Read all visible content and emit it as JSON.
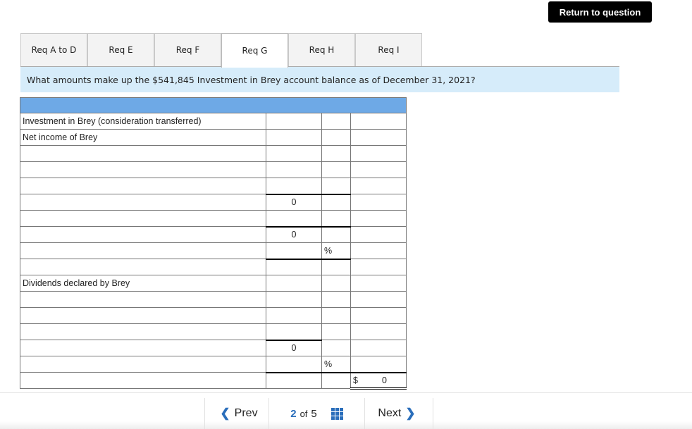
{
  "header": {
    "return_label": "Return to question"
  },
  "tabs": [
    {
      "label": "Req A to D",
      "active": false
    },
    {
      "label": "Req E",
      "active": false
    },
    {
      "label": "Req F",
      "active": false
    },
    {
      "label": "Req G",
      "active": true
    },
    {
      "label": "Req H",
      "active": false
    },
    {
      "label": "Req I",
      "active": false
    }
  ],
  "question": "What amounts make up the $541,845 Investment in Brey account balance as of December 31, 2021?",
  "sheet": {
    "header_color": "#6ea9e6",
    "rows": [
      {
        "label": "Investment in Brey (consideration transferred)",
        "c2": "",
        "c3": "",
        "c4": ""
      },
      {
        "label": "Net income of Brey",
        "c2": "",
        "c3": "",
        "c4": ""
      },
      {
        "label": "",
        "c2": "",
        "c3": "",
        "c4": ""
      },
      {
        "label": "",
        "c2": "",
        "c3": "",
        "c4": ""
      },
      {
        "label": "",
        "c2": "",
        "c3": "",
        "c4": ""
      },
      {
        "label": "",
        "c2": "0",
        "c3": "",
        "c4": ""
      },
      {
        "label": "",
        "c2": "",
        "c3": "",
        "c4": ""
      },
      {
        "label": "",
        "c2": "0",
        "c3": "",
        "c4": ""
      },
      {
        "label": "",
        "c2": "",
        "c3": "%",
        "c4": ""
      },
      {
        "label": "",
        "c2": "",
        "c3": "",
        "c4": ""
      },
      {
        "label": "Dividends declared by Brey",
        "c2": "",
        "c3": "",
        "c4": ""
      },
      {
        "label": "",
        "c2": "",
        "c3": "",
        "c4": ""
      },
      {
        "label": "",
        "c2": "",
        "c3": "",
        "c4": ""
      },
      {
        "label": "",
        "c2": "",
        "c3": "",
        "c4": ""
      },
      {
        "label": "",
        "c2": "0",
        "c3": "",
        "c4": ""
      },
      {
        "label": "",
        "c2": "",
        "c3": "%",
        "c4": ""
      },
      {
        "label": "",
        "c2": "",
        "c3": "",
        "c4_currency": "$",
        "c4": "0"
      }
    ]
  },
  "nav": {
    "prev_label": "Prev",
    "next_label": "Next",
    "current_page": "2",
    "of_label": "of",
    "total_pages": "5",
    "accent_color": "#2a6ebb"
  }
}
